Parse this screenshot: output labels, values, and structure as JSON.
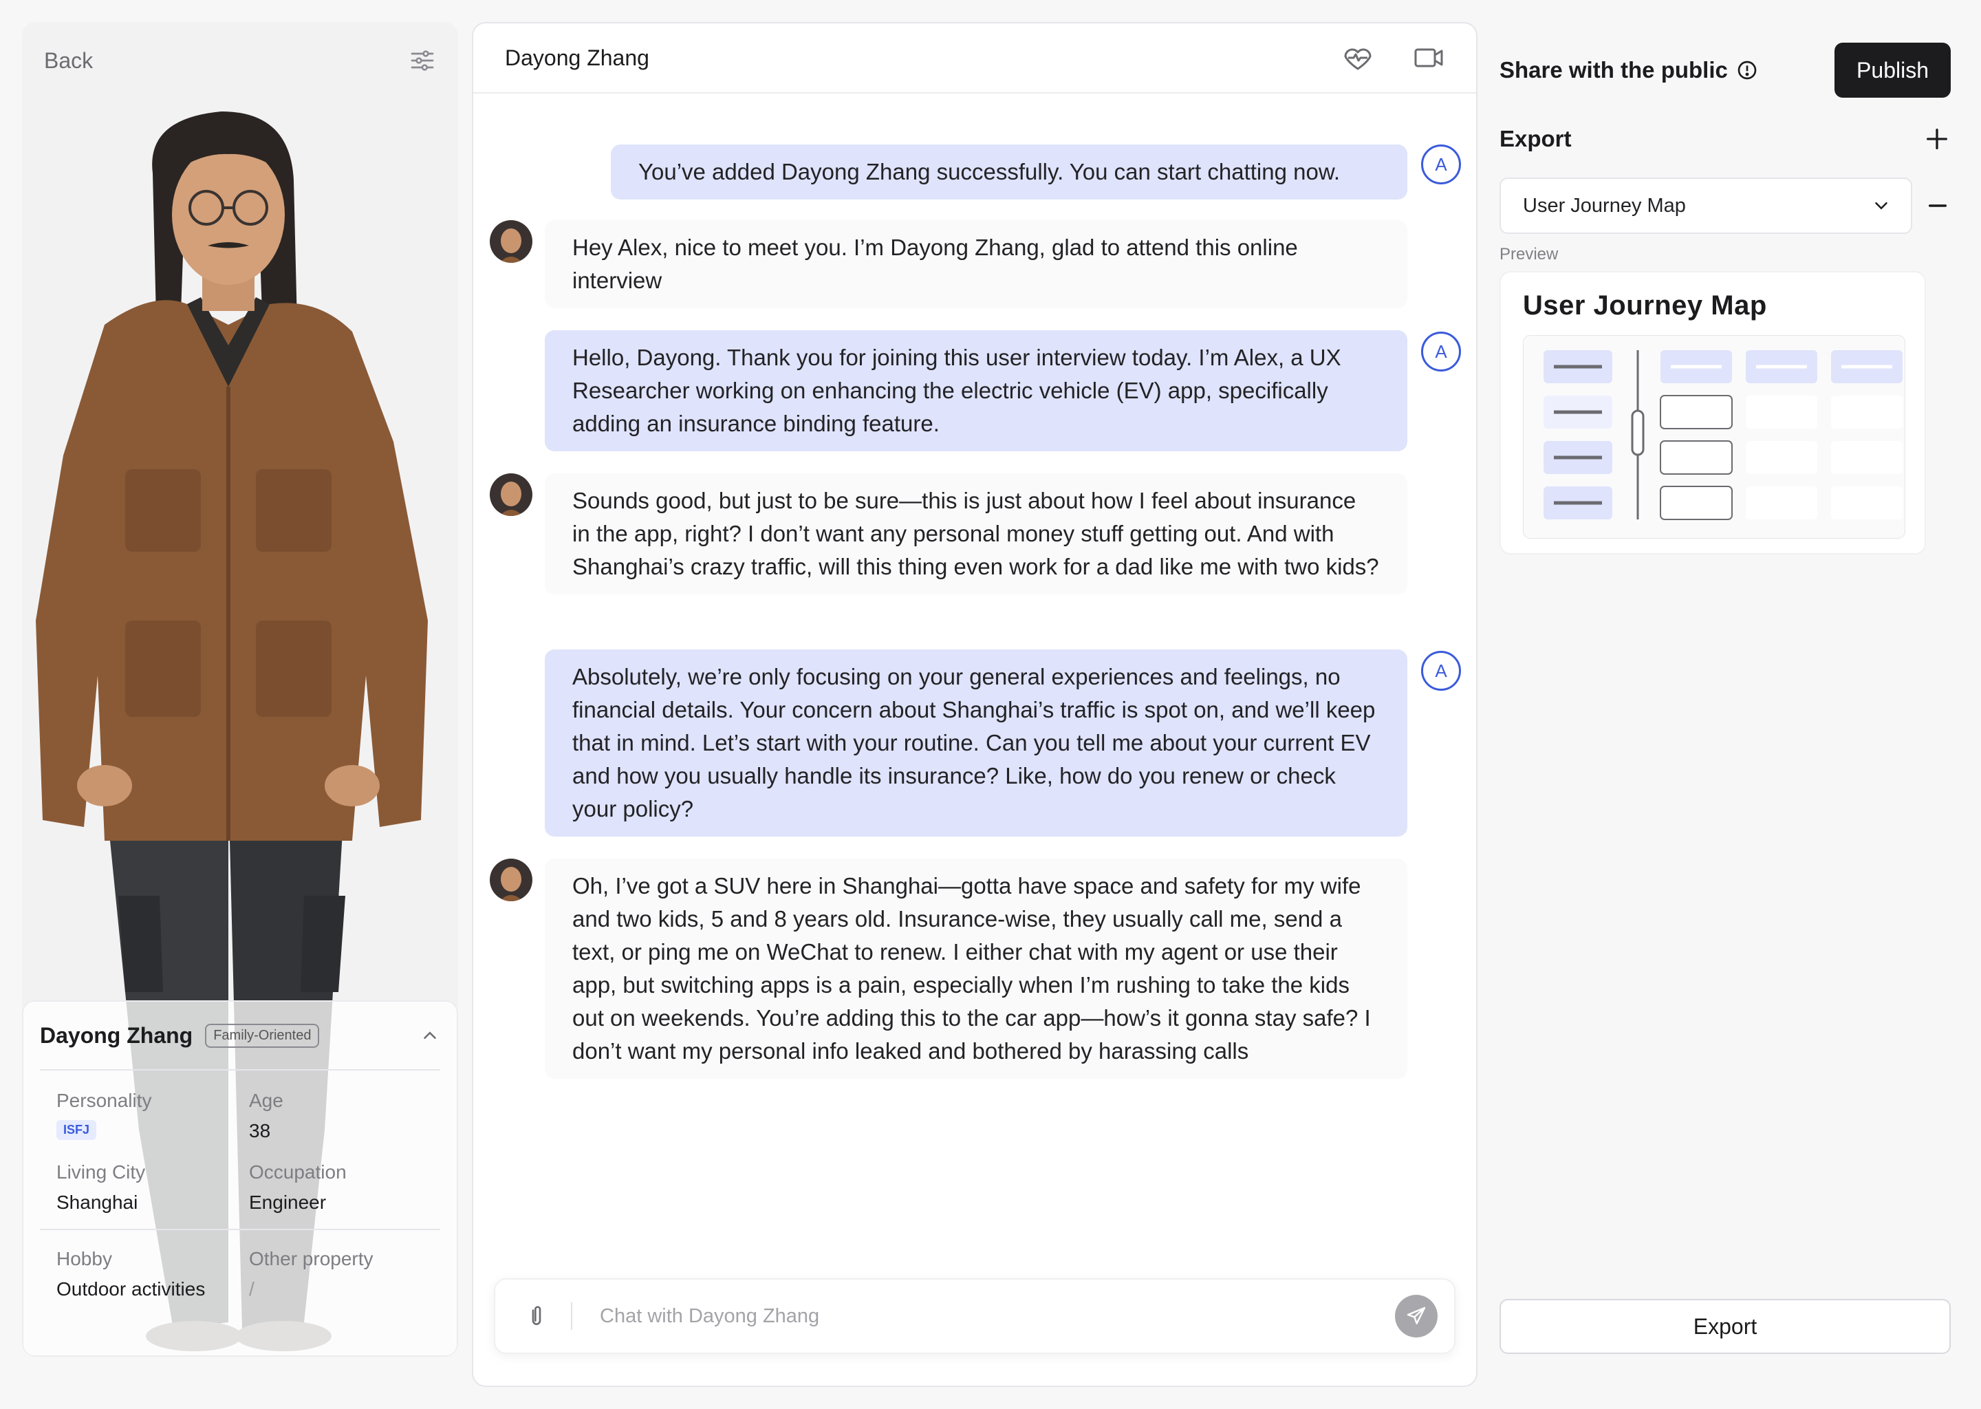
{
  "left_panel": {
    "back_label": "Back",
    "persona": {
      "name": "Dayong Zhang",
      "tag": "Family-Oriented",
      "fields": {
        "personality_label": "Personality",
        "personality_value": "ISFJ",
        "age_label": "Age",
        "age_value": "38",
        "city_label": "Living City",
        "city_value": "Shanghai",
        "occupation_label": "Occupation",
        "occupation_value": "Engineer",
        "hobby_label": "Hobby",
        "hobby_value": "Outdoor activities",
        "other_label": "Other property",
        "other_value": "/"
      }
    }
  },
  "chat": {
    "title": "Dayong Zhang",
    "user_avatar_letter": "A",
    "messages": [
      {
        "role": "user",
        "text": "You’ve added Dayong Zhang successfully. You can start chatting now."
      },
      {
        "role": "bot",
        "text": "Hey Alex, nice to meet you. I’m Dayong Zhang, glad to attend this online interview"
      },
      {
        "role": "user",
        "text": "Hello, Dayong. Thank you for joining this user interview today. I’m Alex, a UX Researcher working on enhancing the electric vehicle (EV) app, specifically adding an insurance binding feature."
      },
      {
        "role": "bot",
        "text": "Sounds good, but just to be sure—this is just about how I feel about insurance in the app, right? I don’t want any personal money stuff getting out. And with Shanghai’s crazy traffic, will this thing even work for a dad like me with two kids?"
      },
      {
        "role": "user",
        "text": "Absolutely, we’re only focusing on your general experiences and feelings, no financial details. Your concern about Shanghai’s traffic is spot on, and we’ll keep that in mind. Let’s start with your routine. Can you tell me about your current EV and how you usually handle its insurance? Like, how do you renew or check your policy?"
      },
      {
        "role": "bot",
        "text": "Oh, I’ve got a SUV here in Shanghai—gotta have space and safety for my wife and two kids, 5 and 8 years old. Insurance-wise, they usually call me, send a text, or ping me on WeChat to renew. I either chat with my agent or use their app, but switching apps is a pain, especially when I’m rushing to take the kids out on weekends. You’re adding this to the car app—how’s it gonna stay safe? I don’t want my personal info leaked and bothered by harassing calls"
      }
    ],
    "input_placeholder": "Chat with Dayong Zhang"
  },
  "right_panel": {
    "share_label": "Share with the public",
    "publish_label": "Publish",
    "export_title": "Export",
    "selected_export": "User Journey Map",
    "preview_label": "Preview",
    "preview_title": "User  Journey Map",
    "export_button": "Export"
  },
  "colors": {
    "accent": "#3b5bdb",
    "user_bubble": "#dfe3fb",
    "dark_button": "#1c1c1e"
  }
}
